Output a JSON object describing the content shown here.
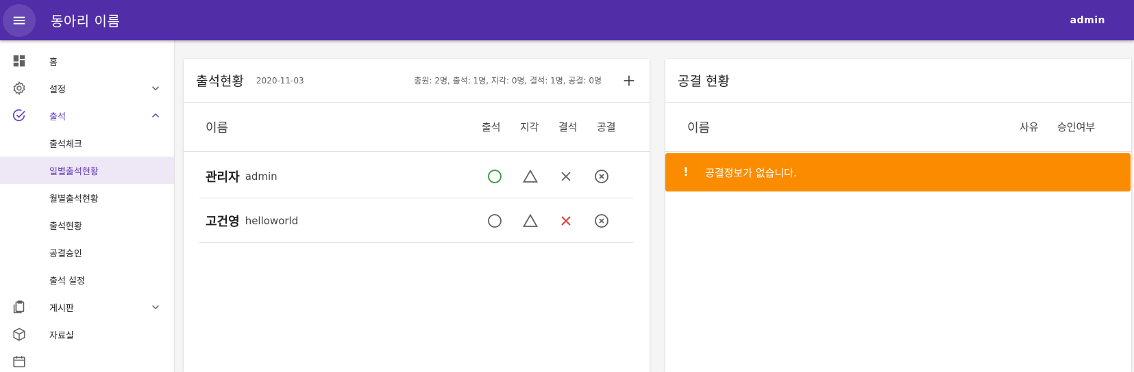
{
  "appbar": {
    "title": "동아리 이름",
    "user": "admin"
  },
  "sidebar": {
    "items": [
      {
        "label": "홈",
        "icon": "dashboard-icon"
      },
      {
        "label": "설정",
        "icon": "gear-icon"
      },
      {
        "label": "출석",
        "icon": "check-circle-icon"
      },
      {
        "label": "게시판",
        "icon": "clipboard-icon"
      },
      {
        "label": "자료실",
        "icon": "package-icon"
      }
    ],
    "attendance_sub": [
      "출석체크",
      "일별출석현황",
      "월별출석현황",
      "출석현황",
      "공결승인",
      "출석 설정"
    ]
  },
  "attendance": {
    "title": "출석현황",
    "date": "2020-11-03",
    "summary": "총원: 2명, 출석: 1명, 지각: 0명, 결석: 1명, 공결: 0명",
    "columns": {
      "name": "이름",
      "present": "출석",
      "late": "지각",
      "absent": "결석",
      "excused": "공결"
    },
    "rows": [
      {
        "name": "관리자",
        "id": "admin",
        "status": "present"
      },
      {
        "name": "고건영",
        "id": "helloworld",
        "status": "absent"
      }
    ]
  },
  "excused": {
    "title": "공결 현황",
    "columns": {
      "name": "이름",
      "reason": "사유",
      "approval": "승인여부"
    },
    "alert_icon": "!",
    "alert_text": "공결정보가 없습니다."
  },
  "colors": {
    "primary": "#512da8",
    "accent": "#673ab7",
    "present": "#43a047",
    "absent": "#e53935",
    "warning": "#fb8c00"
  }
}
